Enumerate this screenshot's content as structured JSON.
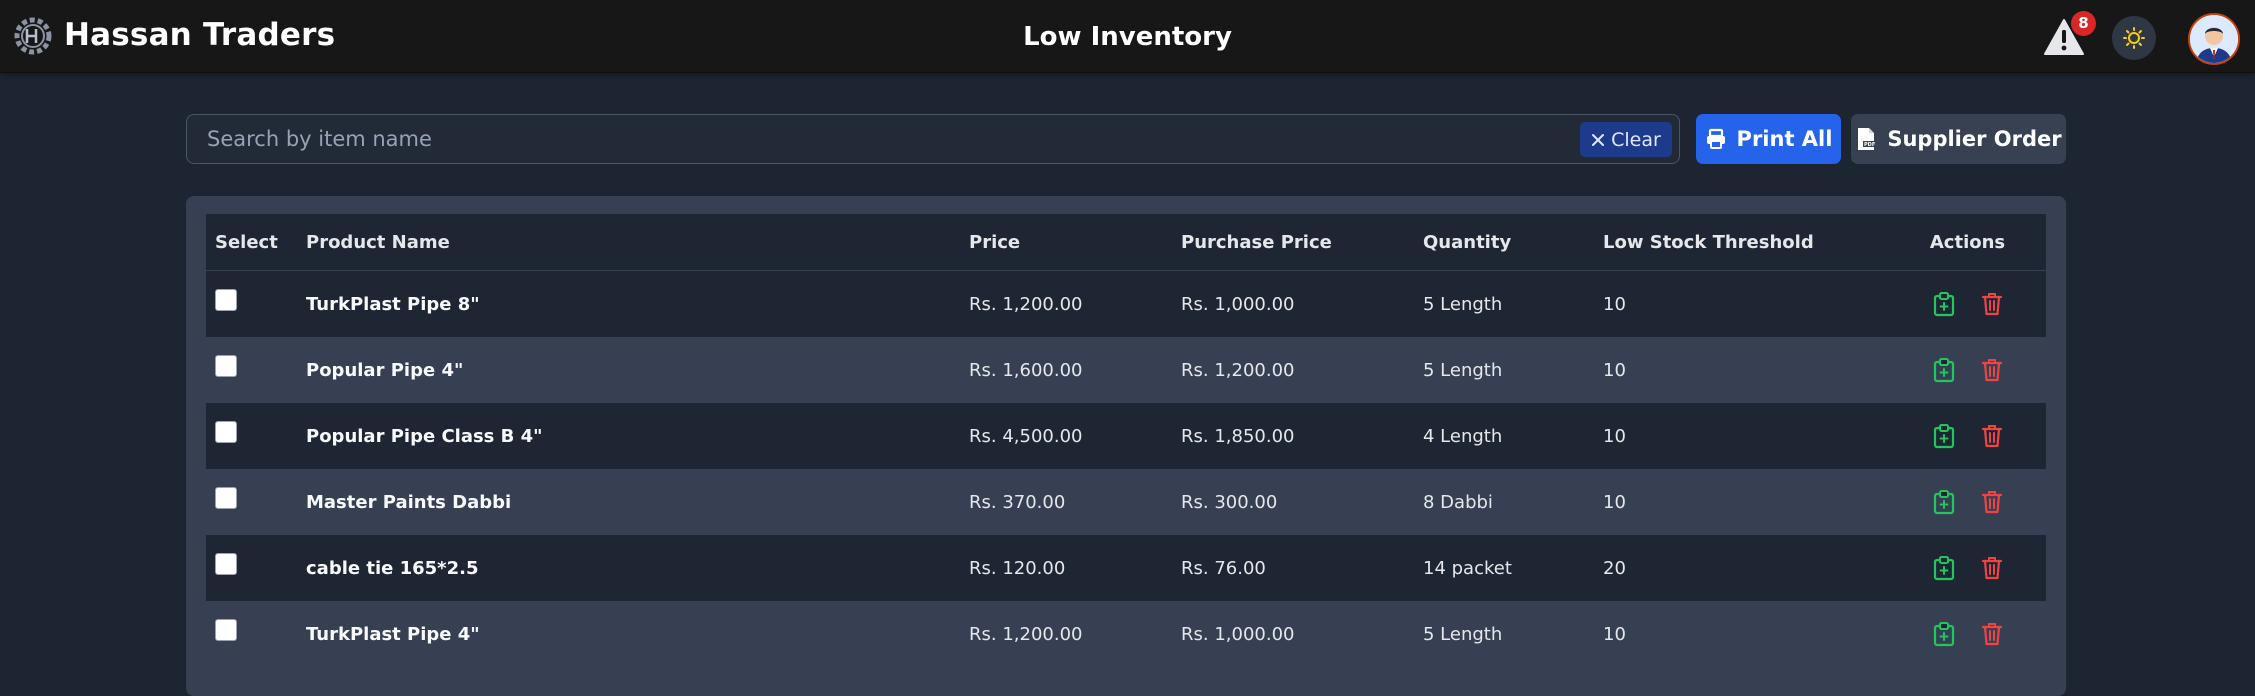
{
  "header": {
    "brand": "Hassan Traders",
    "title": "Low Inventory",
    "alert_count": "8"
  },
  "search": {
    "placeholder": "Search by item name",
    "value": "",
    "clear_label": "Clear"
  },
  "toolbar": {
    "print_label": "Print All",
    "supplier_label": "Supplier Order"
  },
  "table": {
    "columns": [
      "Select",
      "Product Name",
      "Price",
      "Purchase Price",
      "Quantity",
      "Low Stock Threshold",
      "Actions"
    ],
    "rows": [
      {
        "name": "TurkPlast Pipe 8\"",
        "price": "Rs. 1,200.00",
        "purchase": "Rs. 1,000.00",
        "qty": "5 Length",
        "threshold": "10"
      },
      {
        "name": "Popular Pipe 4\"",
        "price": "Rs. 1,600.00",
        "purchase": "Rs. 1,200.00",
        "qty": "5 Length",
        "threshold": "10"
      },
      {
        "name": "Popular Pipe Class B 4\"",
        "price": "Rs. 4,500.00",
        "purchase": "Rs. 1,850.00",
        "qty": "4 Length",
        "threshold": "10"
      },
      {
        "name": "Master Paints Dabbi",
        "price": "Rs. 370.00",
        "purchase": "Rs. 300.00",
        "qty": "8 Dabbi",
        "threshold": "10"
      },
      {
        "name": "cable tie 165*2.5",
        "price": "Rs. 120.00",
        "purchase": "Rs. 76.00",
        "qty": "14 packet",
        "threshold": "20"
      },
      {
        "name": "TurkPlast Pipe 4\"",
        "price": "Rs. 1,200.00",
        "purchase": "Rs. 1,000.00",
        "qty": "5 Length",
        "threshold": "10"
      }
    ]
  },
  "icons": {
    "logo": "gear-logo-icon",
    "alert": "warning-triangle-icon",
    "theme": "sun-icon",
    "clear": "close-icon",
    "print": "printer-icon",
    "supplier": "pdf-file-icon",
    "edit": "clipboard-icon",
    "delete": "trash-icon"
  },
  "colors": {
    "header_bg": "#171717",
    "page_bg": "#1e2532",
    "primary": "#2563eb",
    "danger": "#dc2626",
    "edit": "#22c55e",
    "delete": "#ef4444"
  }
}
